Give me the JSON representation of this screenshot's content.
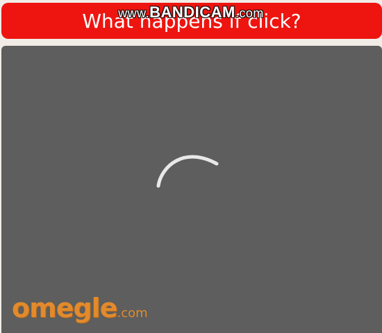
{
  "banner": {
    "text": "What happens if click?",
    "color": "#ee1510"
  },
  "watermark": {
    "prefix": "www.",
    "brand": "BANDICAM",
    "suffix": ".com"
  },
  "video": {
    "background_color": "#5d5e5d",
    "loading_icon": "loading-spinner-icon"
  },
  "logo": {
    "main": "omegle",
    "suffix": ".com",
    "color": "#e28a2c"
  }
}
